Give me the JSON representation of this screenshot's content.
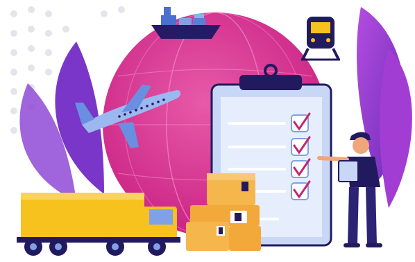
{
  "illustration": {
    "checklist": {
      "items": 5,
      "checked": 4
    },
    "palette": {
      "background": "#ffffff",
      "globe": "#d52b8e",
      "globe_highlight": "#e85aa8",
      "leaf_purple": "#8a3fd1",
      "leaf_violet": "#6a2bb8",
      "leaf_pink": "#c24bd8",
      "clipboard_blue": "#c9d7f7",
      "truck_yellow": "#f7c11e",
      "box_orange": "#f5b64c",
      "navy": "#221a5e",
      "plane_blue": "#7fa2e6",
      "check_pink": "#c2266f"
    },
    "icons": [
      "globe-icon",
      "ship-icon",
      "train-icon",
      "airplane-icon",
      "truck-icon",
      "clipboard-icon",
      "package-icon",
      "courier-icon"
    ]
  }
}
